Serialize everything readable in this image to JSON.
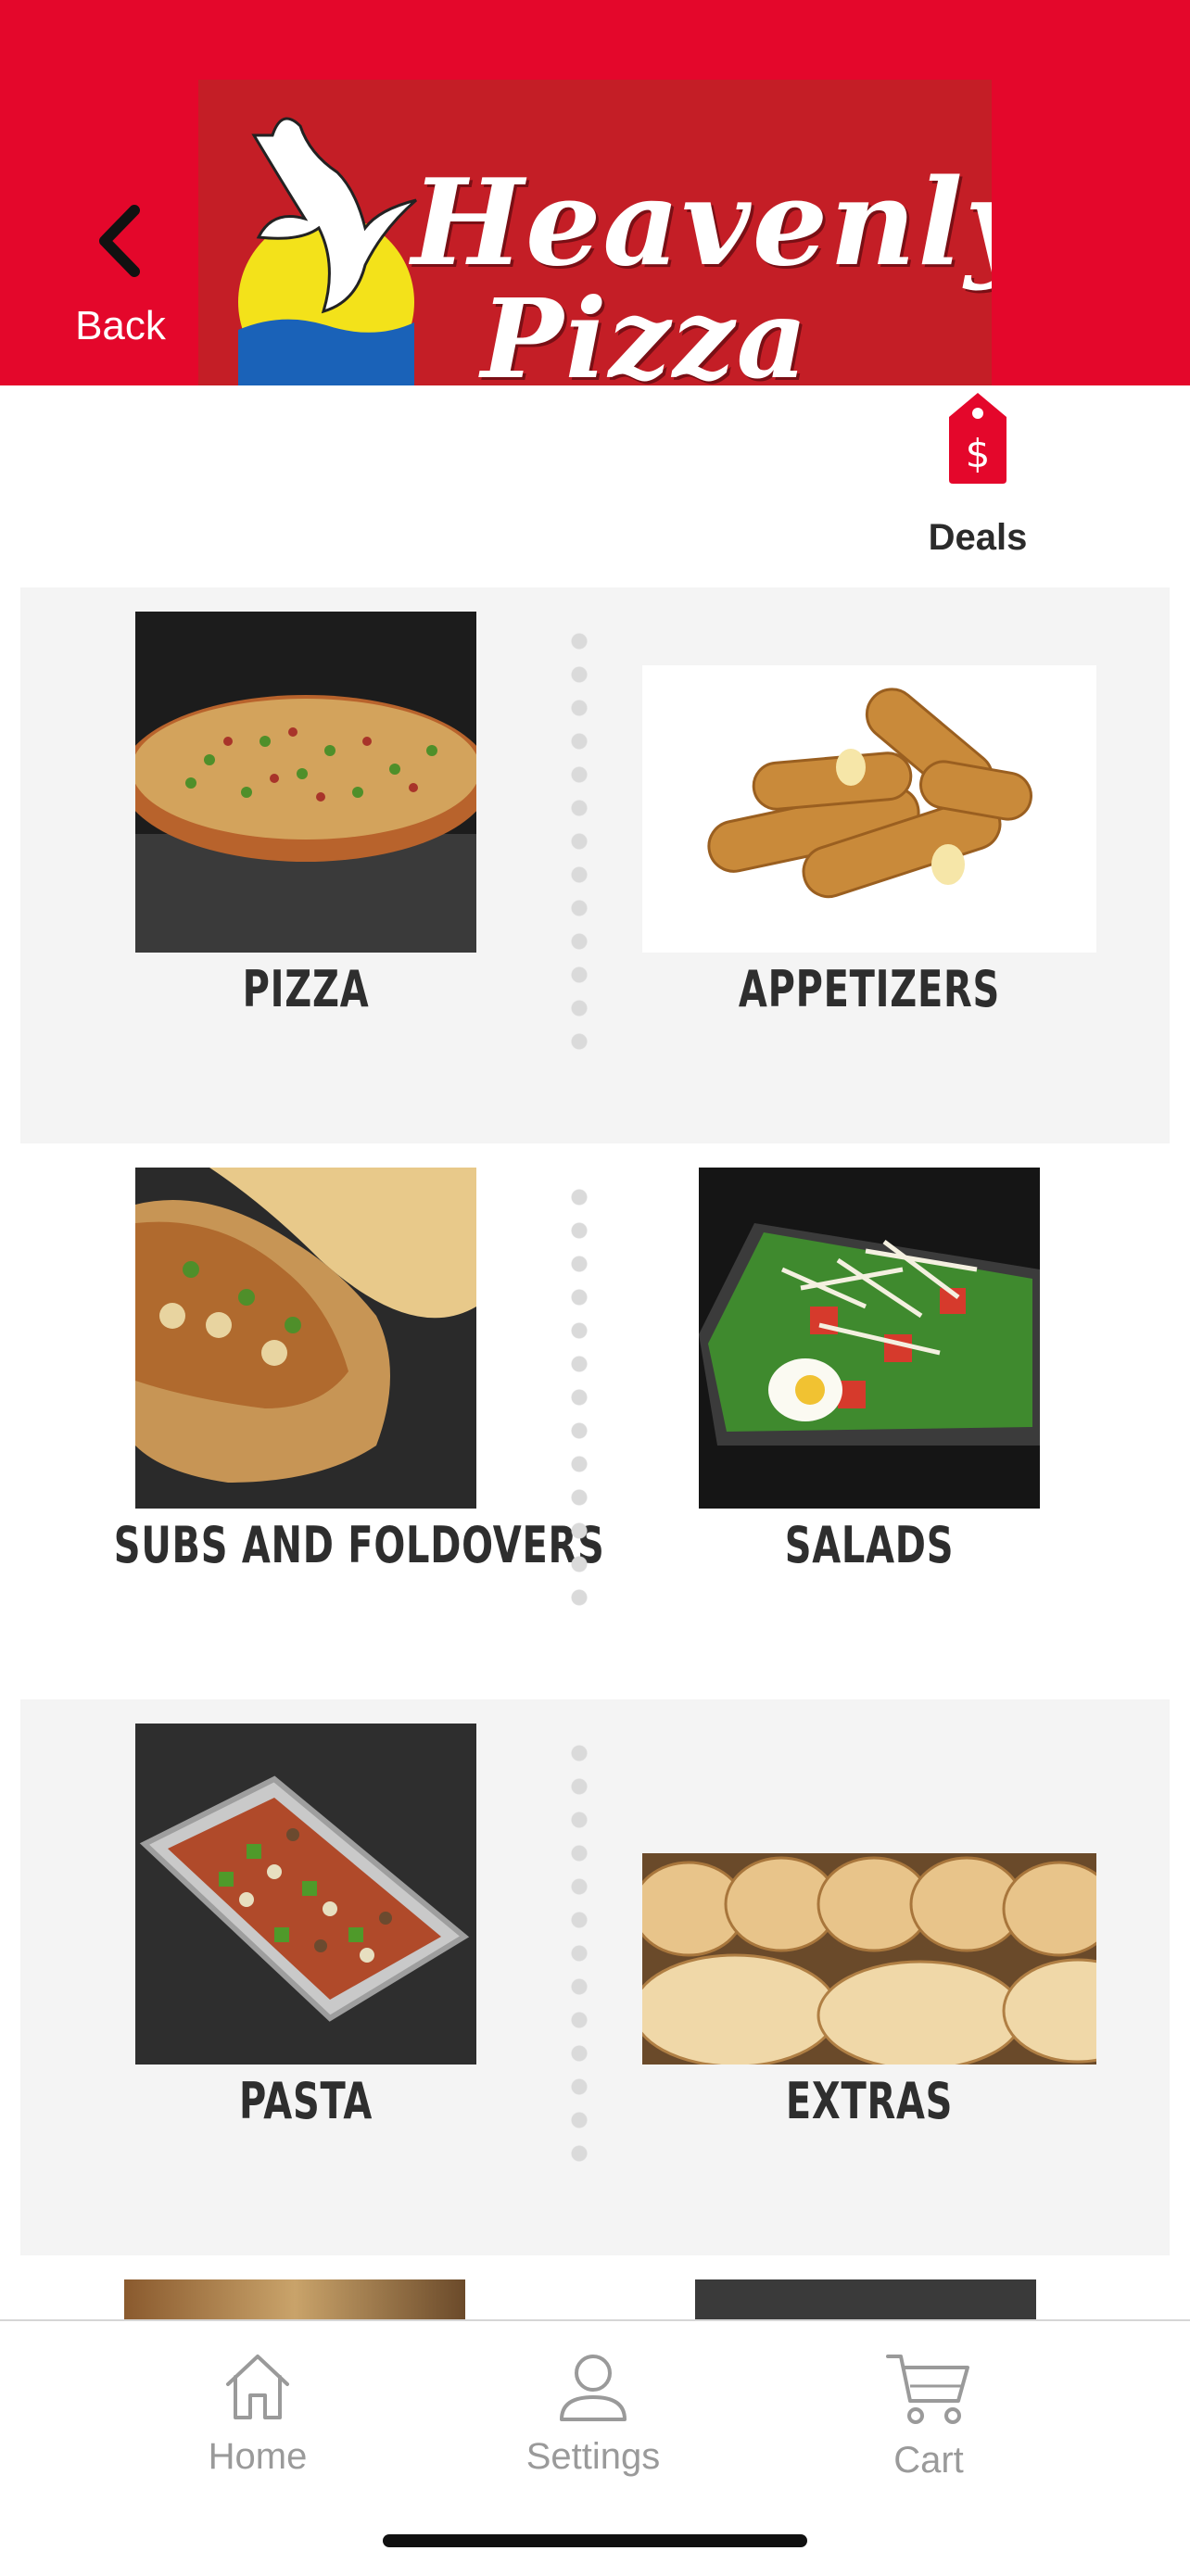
{
  "colors": {
    "brand_red": "#e4072b",
    "logo_red": "#c41e26",
    "text_dark": "#2e2e2e",
    "tab_gray": "#9a9a9a"
  },
  "header": {
    "back_label": "Back",
    "back_icon": "chevron-left-icon",
    "logo": {
      "line1": "Heavenly",
      "line2": "Pizza",
      "icon": "dove-sun-logo"
    }
  },
  "deals": {
    "label": "Deals",
    "icon": "price-tag-dollar-icon"
  },
  "categories": [
    {
      "label": "PIZZA",
      "image": "pizza-photo"
    },
    {
      "label": "APPETIZERS",
      "image": "mozzarella-sticks-photo"
    },
    {
      "label": "SUBS AND FOLDOVERS",
      "image": "sub-sandwich-photo"
    },
    {
      "label": "SALADS",
      "image": "salad-photo"
    },
    {
      "label": "PASTA",
      "image": "pasta-tray-photo"
    },
    {
      "label": "EXTRAS",
      "image": "bread-rolls-photo"
    }
  ],
  "tabbar": {
    "items": [
      {
        "label": "Home",
        "icon": "home-icon"
      },
      {
        "label": "Settings",
        "icon": "person-icon"
      },
      {
        "label": "Cart",
        "icon": "cart-icon"
      }
    ]
  }
}
